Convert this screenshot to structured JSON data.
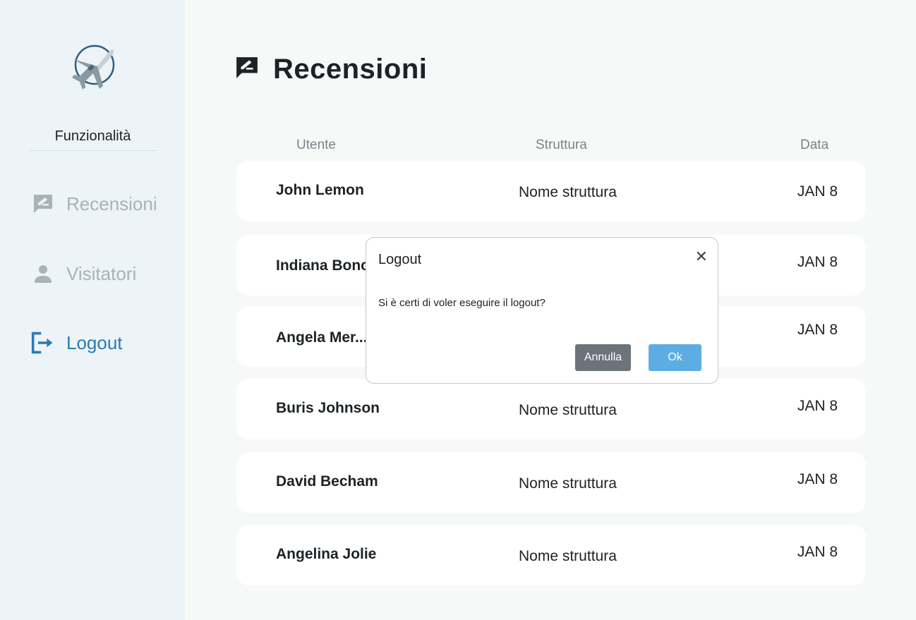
{
  "sidebar": {
    "heading": "Funzionalità",
    "items": [
      {
        "label": "Recensioni",
        "icon": "review-icon"
      },
      {
        "label": "Visitatori",
        "icon": "user-icon"
      },
      {
        "label": "Logout",
        "icon": "logout-icon"
      }
    ]
  },
  "page": {
    "title": "Recensioni",
    "icon": "review-icon"
  },
  "table": {
    "columns": [
      "Utente",
      "Struttura",
      "Data"
    ],
    "rows": [
      {
        "user": "John Lemon",
        "structure": "Nome struttura",
        "date": "JAN 8"
      },
      {
        "user": "Indiana Bonc",
        "structure": "",
        "date": "JAN 8"
      },
      {
        "user": "Angela Mer...",
        "structure": "",
        "date": "JAN 8"
      },
      {
        "user": "Buris Johnson",
        "structure": "Nome struttura",
        "date": "JAN 8"
      },
      {
        "user": "David Becham",
        "structure": "Nome struttura",
        "date": "JAN 8"
      },
      {
        "user": "Angelina Jolie",
        "structure": "Nome struttura",
        "date": "JAN 8"
      }
    ]
  },
  "modal": {
    "title": "Logout",
    "close_icon": "close-icon",
    "message": "Si è certi di voler eseguire il logout?",
    "cancel_label": "Annulla",
    "ok_label": "Ok"
  },
  "colors": {
    "sidebar_bg": "#ecf4f7",
    "active": "#2b7bb4",
    "muted": "#a9b2b7",
    "ok_button": "#5dade2",
    "cancel_button": "#6c737a"
  }
}
